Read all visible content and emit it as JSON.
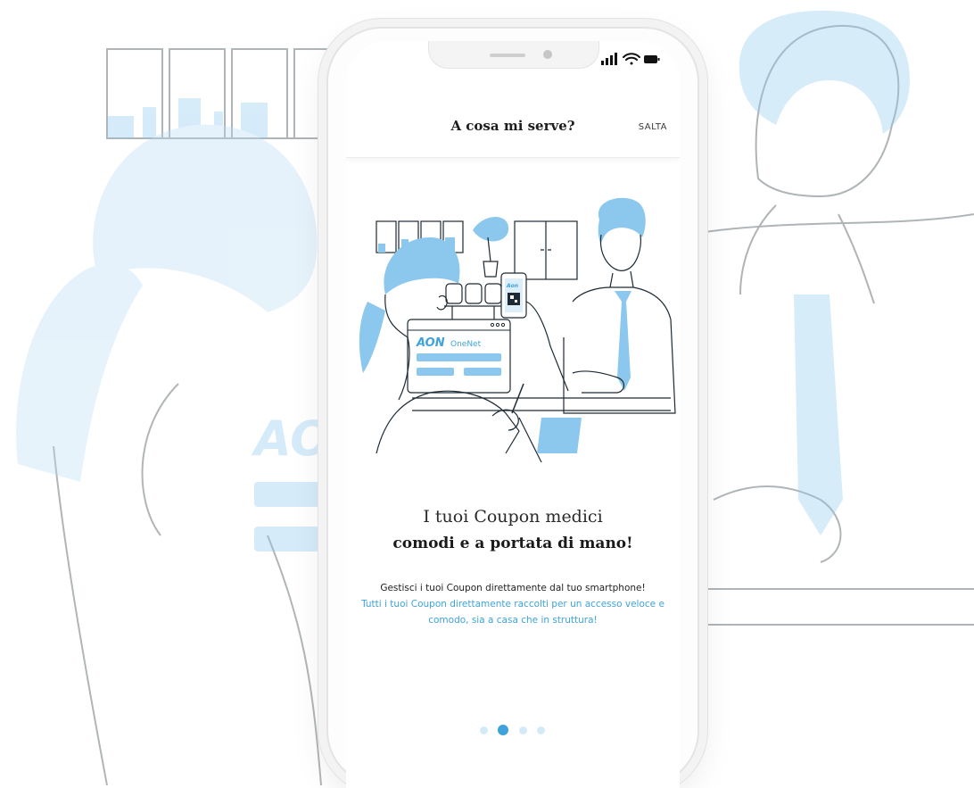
{
  "header": {
    "title": "A cosa mi serve?",
    "skip_label": "SALTA"
  },
  "status_bar": {
    "icons": [
      "signal-icon",
      "wifi-icon",
      "battery-icon"
    ]
  },
  "illustration": {
    "brand_logo": "AON",
    "brand_product": "OneNet",
    "phone_logo": "Aon"
  },
  "content": {
    "headline_light": "I tuoi Coupon medici",
    "headline_bold": "comodi e a portata di mano!",
    "body_dark": "Gestisci i tuoi Coupon direttamente dal tuo smartphone!",
    "body_highlight": "Tutti i tuoi Coupon direttamente raccolti per un accesso veloce e comodo, sia a casa che in struttura!"
  },
  "pagination": {
    "total": 4,
    "active_index": 1
  },
  "colors": {
    "accent": "#3fa3db",
    "illustration_fill": "#8cc8ee",
    "illustration_light": "#dbeef9",
    "line": "#1e2a33"
  }
}
